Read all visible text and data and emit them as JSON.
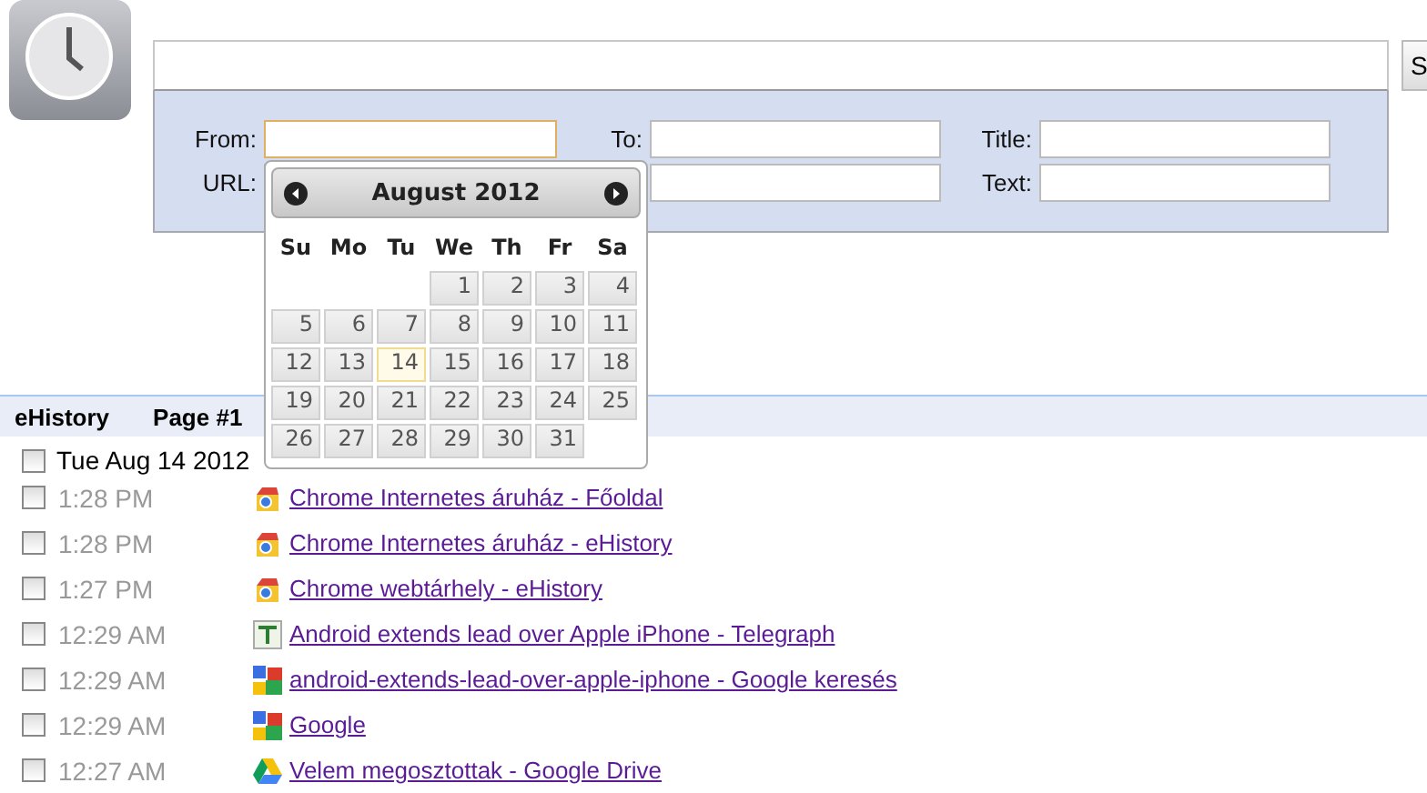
{
  "search": {
    "button": "S"
  },
  "filters": [
    {
      "label": "From:",
      "focused": true
    },
    {
      "label": "To:",
      "focused": false
    },
    {
      "label": "Title:",
      "focused": false
    },
    {
      "label": "URL:",
      "focused": false
    },
    {
      "focused": false
    },
    {
      "label": "Text:",
      "focused": false
    }
  ],
  "calendar": {
    "title": "August 2012",
    "weekdays": [
      "Su",
      "Mo",
      "Tu",
      "We",
      "Th",
      "Fr",
      "Sa"
    ],
    "weeks": [
      [
        {
          "kind": "empty"
        },
        {
          "kind": "empty"
        },
        {
          "kind": "empty"
        },
        {
          "kind": "day",
          "day": "1",
          "today": false
        },
        {
          "kind": "day",
          "day": "2",
          "today": false
        },
        {
          "kind": "day",
          "day": "3",
          "today": false
        },
        {
          "kind": "day",
          "day": "4",
          "today": false
        }
      ],
      [
        {
          "kind": "day",
          "day": "5",
          "today": false
        },
        {
          "kind": "day",
          "day": "6",
          "today": false
        },
        {
          "kind": "day",
          "day": "7",
          "today": false
        },
        {
          "kind": "day",
          "day": "8",
          "today": false
        },
        {
          "kind": "day",
          "day": "9",
          "today": false
        },
        {
          "kind": "day",
          "day": "10",
          "today": false
        },
        {
          "kind": "day",
          "day": "11",
          "today": false
        }
      ],
      [
        {
          "kind": "day",
          "day": "12",
          "today": false
        },
        {
          "kind": "day",
          "day": "13",
          "today": false
        },
        {
          "kind": "day",
          "day": "14",
          "today": true
        },
        {
          "kind": "day",
          "day": "15",
          "today": false
        },
        {
          "kind": "day",
          "day": "16",
          "today": false
        },
        {
          "kind": "day",
          "day": "17",
          "today": false
        },
        {
          "kind": "day",
          "day": "18",
          "today": false
        }
      ],
      [
        {
          "kind": "day",
          "day": "19",
          "today": false
        },
        {
          "kind": "day",
          "day": "20",
          "today": false
        },
        {
          "kind": "day",
          "day": "21",
          "today": false
        },
        {
          "kind": "day",
          "day": "22",
          "today": false
        },
        {
          "kind": "day",
          "day": "23",
          "today": false
        },
        {
          "kind": "day",
          "day": "24",
          "today": false
        },
        {
          "kind": "day",
          "day": "25",
          "today": false
        }
      ],
      [
        {
          "kind": "day",
          "day": "26",
          "today": false
        },
        {
          "kind": "day",
          "day": "27",
          "today": false
        },
        {
          "kind": "day",
          "day": "28",
          "today": false
        },
        {
          "kind": "day",
          "day": "29",
          "today": false
        },
        {
          "kind": "day",
          "day": "30",
          "today": false
        },
        {
          "kind": "day",
          "day": "31",
          "today": false
        },
        {
          "kind": "empty"
        }
      ]
    ]
  },
  "history": {
    "title": "eHistory",
    "page": "Page #1",
    "date": {
      "label": "Tue Aug 14 2012",
      "checked": false
    },
    "entries": [
      {
        "time": "1:28 PM",
        "kind": "store",
        "title": "Chrome Internetes áruház - Főoldal",
        "checked": false
      },
      {
        "time": "1:28 PM",
        "kind": "store",
        "title": "Chrome Internetes áruház - eHistory",
        "checked": false
      },
      {
        "time": "1:27 PM",
        "kind": "store",
        "title": "Chrome webtárhely - eHistory",
        "checked": false
      },
      {
        "time": "12:29 AM",
        "kind": "news",
        "title": "Android extends lead over Apple iPhone - Telegraph",
        "checked": false
      },
      {
        "time": "12:29 AM",
        "kind": "search",
        "title": "android-extends-lead-over-apple-iphone - Google keresés",
        "checked": false
      },
      {
        "time": "12:29 AM",
        "kind": "search",
        "title": "Google",
        "checked": false
      },
      {
        "time": "12:27 AM",
        "kind": "drive",
        "title": "Velem megosztottak - Google Drive",
        "checked": false
      }
    ]
  }
}
